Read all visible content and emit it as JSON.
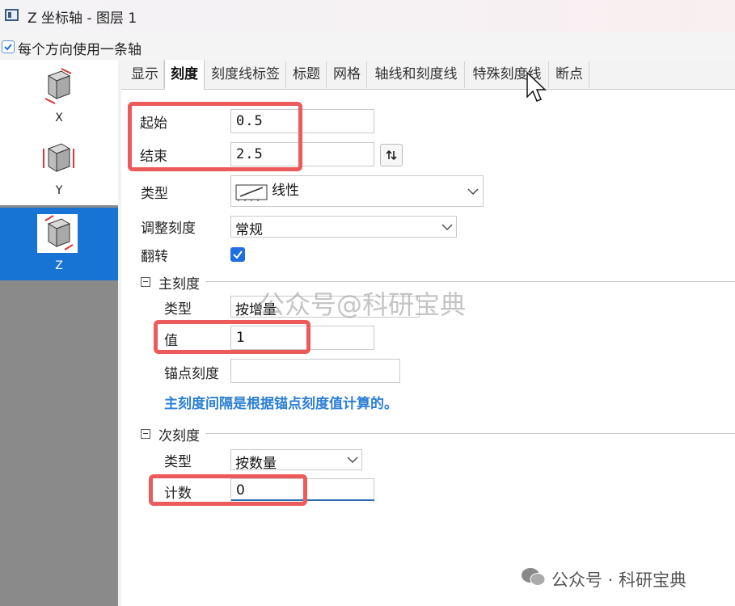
{
  "window": {
    "title": "Z 坐标轴 - 图层 1"
  },
  "top_option": {
    "label": "每个方向使用一条轴",
    "checked": true
  },
  "sidebar": {
    "items": [
      {
        "label": "X",
        "icon": "cube-x-axis-icon",
        "selected": false
      },
      {
        "label": "Y",
        "icon": "cube-y-axis-icon",
        "selected": false
      },
      {
        "label": "Z",
        "icon": "cube-z-axis-icon",
        "selected": true
      }
    ]
  },
  "tabs": [
    {
      "label": "显示",
      "active": false
    },
    {
      "label": "刻度",
      "active": true
    },
    {
      "label": "刻度线标签",
      "active": false
    },
    {
      "label": "标题",
      "active": false
    },
    {
      "label": "网格",
      "active": false
    },
    {
      "label": "轴线和刻度线",
      "active": false
    },
    {
      "label": "特殊刻度线",
      "active": false
    },
    {
      "label": "断点",
      "active": false
    }
  ],
  "scale": {
    "start_label": "起始",
    "start_value": "0.5",
    "end_label": "结束",
    "end_value": "2.5",
    "type_label": "类型",
    "type_value": "线性",
    "rescale_label": "调整刻度",
    "rescale_value": "常规",
    "reverse_label": "翻转",
    "reverse_checked": true
  },
  "major": {
    "header": "主刻度",
    "type_label": "类型",
    "type_value": "按增量",
    "value_label": "值",
    "value": "1",
    "anchor_label": "锚点刻度",
    "anchor_value": "",
    "note": "主刻度间隔是根据锚点刻度值计算的。"
  },
  "minor": {
    "header": "次刻度",
    "type_label": "类型",
    "type_value": "按数量",
    "count_label": "计数",
    "count_value": "0"
  },
  "watermark": {
    "center": "公众号@科研宝典",
    "bottom": "公众号 · 科研宝典"
  },
  "colors": {
    "accent": "#1874d4",
    "highlight": "#ec5a5a",
    "note": "#2b7fd6"
  }
}
